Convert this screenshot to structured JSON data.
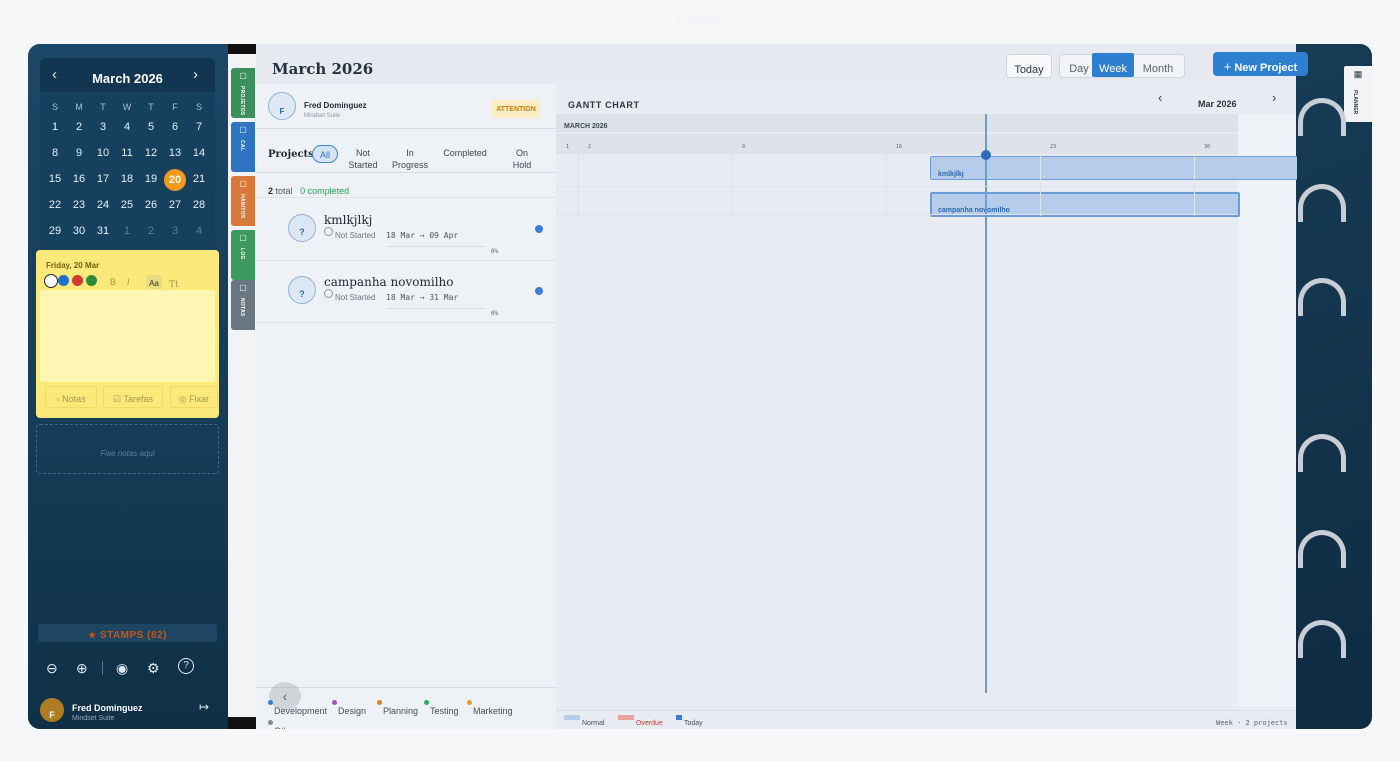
{
  "app_title": "Projects",
  "calendar": {
    "month_label": "March 2026",
    "prev": "‹",
    "next": "›",
    "dow": [
      "S",
      "M",
      "T",
      "W",
      "T",
      "F",
      "S"
    ],
    "weeks": [
      [
        "1",
        "2",
        "3",
        "4",
        "5",
        "6",
        "7"
      ],
      [
        "8",
        "9",
        "10",
        "11",
        "12",
        "13",
        "14"
      ],
      [
        "15",
        "16",
        "17",
        "18",
        "19",
        "20",
        "21"
      ],
      [
        "22",
        "23",
        "24",
        "25",
        "26",
        "27",
        "28"
      ],
      [
        "29",
        "30",
        "31",
        "1",
        "2",
        "3",
        "4"
      ]
    ],
    "today": "20"
  },
  "note": {
    "date": "Friday, 20 Mar",
    "colors": [
      "#ffffff",
      "#1e6fd0",
      "#d23b2f",
      "#2e8b3e"
    ],
    "bold": "B",
    "italic": "I",
    "font_small": "Aa",
    "font_large": "Tt",
    "actions": [
      "Notas",
      "Tarefas",
      "Fixar"
    ]
  },
  "pin_placeholder": "Fixe notas aqui",
  "stamps": "STAMPS (82)",
  "user": {
    "initial": "F",
    "name": "Fred Dominguez",
    "sub": "Mindset Suite"
  },
  "side_tabs": [
    {
      "label": "PROJETOS",
      "color": "#3a8f5a"
    },
    {
      "label": "CAL",
      "color": "#2f74c0"
    },
    {
      "label": "HÁBITOS",
      "color": "#d8783a"
    },
    {
      "label": "LOG",
      "color": "#3d9a5e"
    },
    {
      "label": "NOTAS",
      "color": "#6b7780"
    }
  ],
  "header": {
    "title": "March 2026",
    "today": "Today",
    "views": [
      "Day",
      "Week",
      "Month"
    ],
    "active_view": "Week",
    "new_project": "New Project"
  },
  "profile": {
    "initial": "F",
    "name": "Fred Dominguez",
    "sub": "Mindset Suite",
    "badge": "ATTENTION"
  },
  "projects": {
    "heading": "Projects",
    "filters": [
      "All",
      "Not\nStarted",
      "In\nProgress",
      "Completed",
      "On\nHold"
    ],
    "total_count": "2",
    "total_label": "total",
    "completed_label": "0 completed",
    "items": [
      {
        "icon": "?",
        "title": "kmlkjlkj",
        "status": "Not Started",
        "dates": "18 Mar → 09 Apr",
        "progress": "0%"
      },
      {
        "icon": "?",
        "title": "campanha novomilho",
        "status": "Not Started",
        "dates": "18 Mar → 31 Mar",
        "progress": "0%"
      }
    ],
    "categories": [
      {
        "label": "Development",
        "color": "#3b7dd8"
      },
      {
        "label": "Design",
        "color": "#9b59b6"
      },
      {
        "label": "Planning",
        "color": "#e67e22"
      },
      {
        "label": "Testing",
        "color": "#27ae60"
      },
      {
        "label": "Marketing",
        "color": "#e2a022"
      },
      {
        "label": "Other",
        "color": "#7f8c8d"
      }
    ]
  },
  "gantt": {
    "heading": "GANTT CHART",
    "month_nav": "Mar 2026",
    "month_row": "MARCH 2026",
    "ticks": [
      "1",
      "2",
      "9",
      "16",
      "23",
      "30"
    ],
    "bars": [
      "kmlkjlkj",
      "campanha novomilho"
    ],
    "legend": [
      {
        "label": "Normal",
        "color": "#b5cdea"
      },
      {
        "label": "Overdue",
        "color": "#e8a0a0"
      },
      {
        "label": "Today",
        "color": "#3b7dd8"
      }
    ],
    "footer": "Week · 2 projects"
  },
  "planner_tab": "PLANNER"
}
